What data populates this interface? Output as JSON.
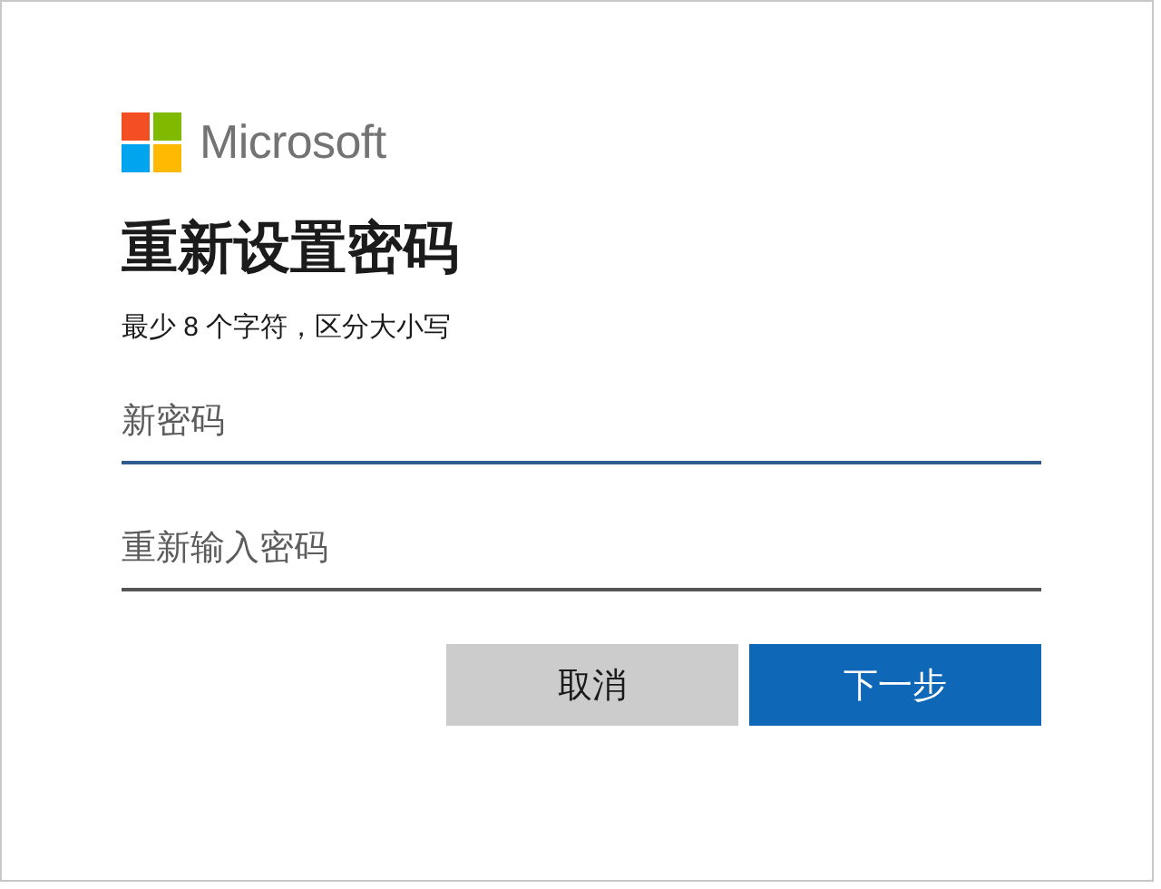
{
  "logo": {
    "text": "Microsoft"
  },
  "title": "重新设置密码",
  "hint": "最少 8 个字符，区分大小写",
  "fields": [
    {
      "placeholder": "新密码",
      "focused": true
    },
    {
      "placeholder": "重新输入密码",
      "focused": false
    }
  ],
  "buttons": [
    {
      "label": "取消",
      "kind": "secondary"
    },
    {
      "label": "下一步",
      "kind": "primary"
    }
  ]
}
